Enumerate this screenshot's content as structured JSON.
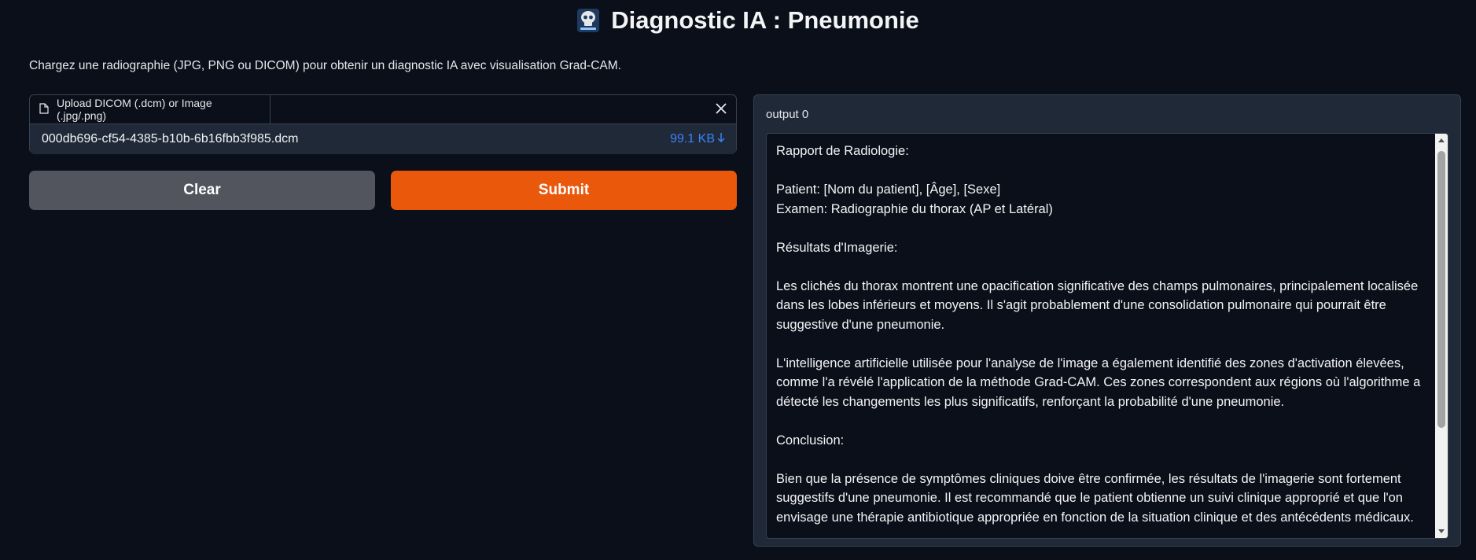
{
  "header": {
    "emoji": "skull-xray-icon",
    "title": "Diagnostic IA : Pneumonie"
  },
  "description": "Chargez une radiographie (JPG, PNG ou DICOM) pour obtenir un diagnostic IA avec visualisation Grad-CAM.",
  "upload": {
    "tab_label": "Upload DICOM (.dcm) or Image (.jpg/.png)",
    "file_name": "000db696-cf54-4385-b10b-6b16fbb3f985.dcm",
    "file_size": "99.1 KB"
  },
  "buttons": {
    "clear": "Clear",
    "submit": "Submit"
  },
  "output": {
    "label": "output 0",
    "text": "Rapport de Radiologie:\n\nPatient: [Nom du patient], [Âge], [Sexe]\nExamen: Radiographie du thorax (AP et Latéral)\n\nRésultats d'Imagerie:\n\nLes clichés du thorax montrent une opacification significative des champs pulmonaires, principalement localisée dans les lobes inférieurs et moyens. Il s'agit probablement d'une consolidation pulmonaire qui pourrait être suggestive d'une pneumonie.\n\nL'intelligence artificielle utilisée pour l'analyse de l'image a également identifié des zones d'activation élevées, comme l'a révélé l'application de la méthode Grad-CAM. Ces zones correspondent aux régions où l'algorithme a détecté les changements les plus significatifs, renforçant la probabilité d'une pneumonie.\n\nConclusion:\n\nBien que la présence de symptômes cliniques doive être confirmée, les résultats de l'imagerie sont fortement suggestifs d'une pneumonie. Il est recommandé que le patient obtienne un suivi clinique approprié et que l'on envisage une thérapie antibiotique appropriée en fonction de la situation clinique et des antécédents médicaux."
  },
  "colors": {
    "background": "#0b0f19",
    "panel": "#1f2937",
    "submit": "#ea580c",
    "clear": "#52555e",
    "link": "#3b82f6"
  }
}
